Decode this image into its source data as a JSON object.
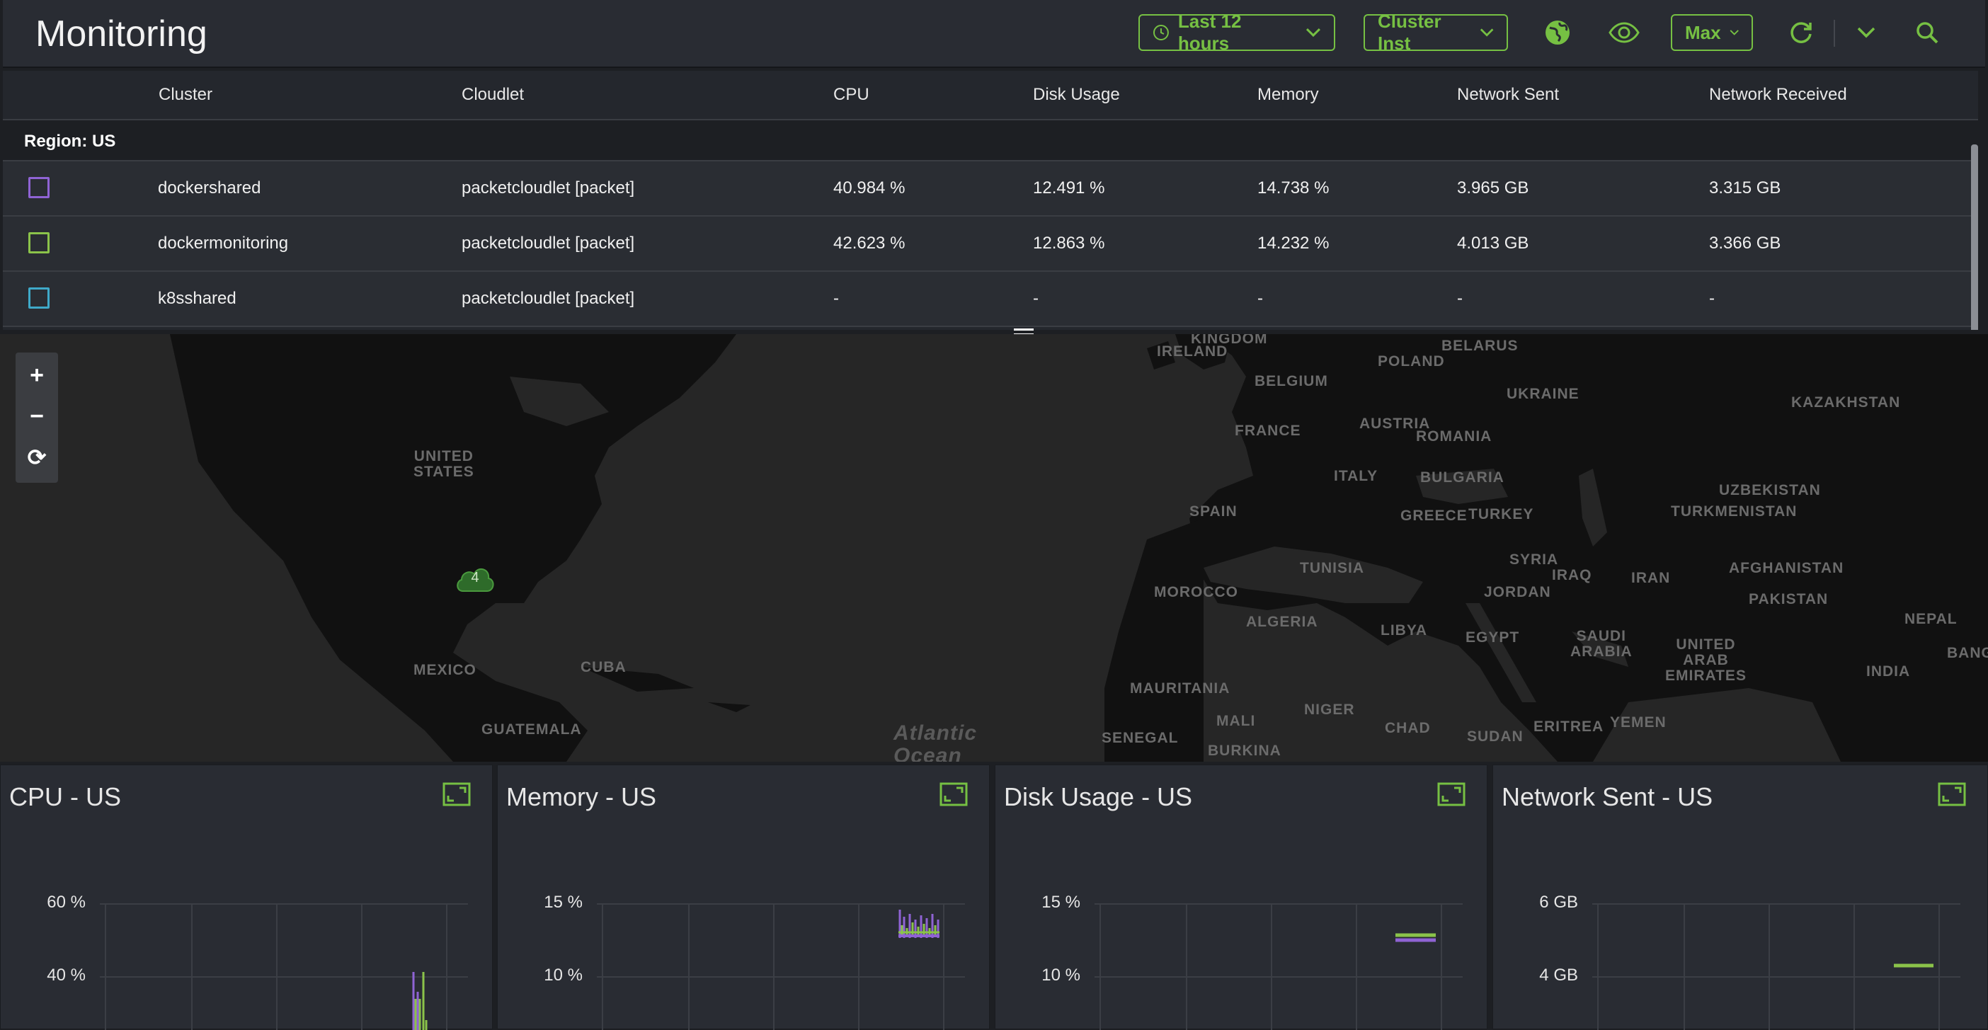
{
  "header": {
    "title": "Monitoring",
    "time_range": "Last 12 hours",
    "view_type": "Cluster Inst",
    "aggregation": "Max",
    "icons": [
      "clock-icon",
      "globe-icon",
      "eye-icon",
      "refresh-icon",
      "chevron-down-icon",
      "search-icon"
    ]
  },
  "table": {
    "columns": [
      "Cluster",
      "Cloudlet",
      "CPU",
      "Disk Usage",
      "Memory",
      "Network Sent",
      "Network Received"
    ],
    "region_label": "Region: US",
    "rows": [
      {
        "color": "#8f63d4",
        "cluster": "dockershared",
        "cloudlet": "packetcloudlet [packet]",
        "cpu": "40.984 %",
        "disk": "12.491 %",
        "memory": "14.738 %",
        "net_sent": "3.965 GB",
        "net_recv": "3.315 GB"
      },
      {
        "color": "#8bc34a",
        "cluster": "dockermonitoring",
        "cloudlet": "packetcloudlet [packet]",
        "cpu": "42.623 %",
        "disk": "12.863 %",
        "memory": "14.232 %",
        "net_sent": "4.013 GB",
        "net_recv": "3.366 GB"
      },
      {
        "color": "#3fa9c9",
        "cluster": "k8sshared",
        "cloudlet": "packetcloudlet [packet]",
        "cpu": "-",
        "disk": "-",
        "memory": "-",
        "net_sent": "-",
        "net_recv": "-"
      }
    ]
  },
  "map": {
    "zoom_in": "+",
    "zoom_out": "−",
    "reset": "⟳",
    "cluster_count": "4",
    "labels": [
      {
        "text": "KINGDOM"
      },
      {
        "text": "IRELAND"
      },
      {
        "text": "BELARUS"
      },
      {
        "text": "POLAND"
      },
      {
        "text": "BELGIUM"
      },
      {
        "text": "UKRAINE"
      },
      {
        "text": "KAZAKHSTAN"
      },
      {
        "text": "AUSTRIA"
      },
      {
        "text": "FRANCE"
      },
      {
        "text": "ROMANIA"
      },
      {
        "text": "UNITED\nSTATES"
      },
      {
        "text": "ITALY"
      },
      {
        "text": "BULGARIA"
      },
      {
        "text": "UZBEKISTAN"
      },
      {
        "text": "SPAIN"
      },
      {
        "text": "GREECE"
      },
      {
        "text": "TURKEY"
      },
      {
        "text": "TURKMENISTAN"
      },
      {
        "text": "TUNISIA"
      },
      {
        "text": "SYRIA"
      },
      {
        "text": "IRAQ"
      },
      {
        "text": "IRAN"
      },
      {
        "text": "AFGHANISTAN"
      },
      {
        "text": "MOROCCO"
      },
      {
        "text": "JORDAN"
      },
      {
        "text": "PAKISTAN"
      },
      {
        "text": "ALGERIA"
      },
      {
        "text": "LIBYA"
      },
      {
        "text": "EGYPT"
      },
      {
        "text": "NEPAL"
      },
      {
        "text": "SAUDI\nARABIA"
      },
      {
        "text": "UNITED\nARAB\nEMIRATES"
      },
      {
        "text": "INDIA"
      },
      {
        "text": "BANGL"
      },
      {
        "text": "MEXICO"
      },
      {
        "text": "CUBA"
      },
      {
        "text": "MAURITANIA"
      },
      {
        "text": "NIGER"
      },
      {
        "text": "GUATEMALA"
      },
      {
        "text": "MALI"
      },
      {
        "text": "CHAD"
      },
      {
        "text": "SUDAN"
      },
      {
        "text": "ERITREA"
      },
      {
        "text": "YEMEN"
      },
      {
        "text": "SENEGAL"
      },
      {
        "text": "BURKINA"
      }
    ],
    "ocean_label": "Atlantic\nOcean"
  },
  "panels": [
    {
      "title": "CPU - US",
      "yticks": [
        "60 %",
        "40 %"
      ]
    },
    {
      "title": "Memory - US",
      "yticks": [
        "15 %",
        "10 %"
      ]
    },
    {
      "title": "Disk Usage - US",
      "yticks": [
        "15 %",
        "10 %"
      ]
    },
    {
      "title": "Network Sent - US",
      "yticks": [
        "6 GB",
        "4 GB"
      ]
    }
  ],
  "colors": {
    "accent": "#76c043",
    "series_a": "#8f63d4",
    "series_b": "#8bc34a",
    "series_c": "#3fa9c9"
  }
}
